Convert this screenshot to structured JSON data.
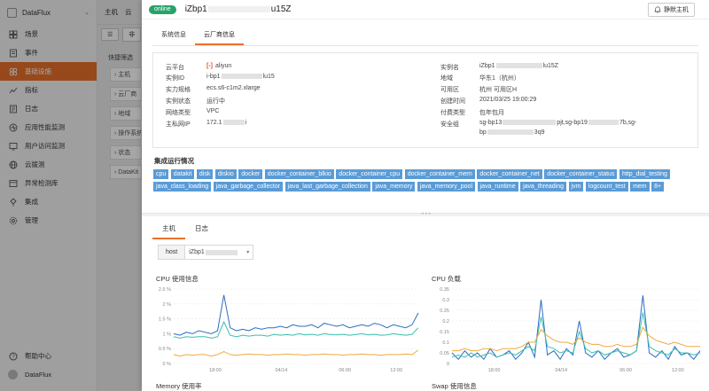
{
  "sidebar": {
    "app_name": "DataFlux",
    "items": [
      {
        "label": "场景",
        "icon": "scene-icon"
      },
      {
        "label": "事件",
        "icon": "event-icon"
      },
      {
        "label": "基础设施",
        "icon": "infrastructure-icon",
        "active": true
      },
      {
        "label": "指标",
        "icon": "metrics-icon"
      },
      {
        "label": "日志",
        "icon": "log-icon"
      },
      {
        "label": "应用性能监测",
        "icon": "apm-icon"
      },
      {
        "label": "用户访问监测",
        "icon": "rum-icon"
      },
      {
        "label": "云拨测",
        "icon": "dial-test-icon"
      },
      {
        "label": "异常检测库",
        "icon": "anomaly-icon"
      },
      {
        "label": "集成",
        "icon": "integration-icon"
      },
      {
        "label": "管理",
        "icon": "management-icon"
      }
    ],
    "help": "帮助中心",
    "account": "DataFlux"
  },
  "middle": {
    "tab_main": "主机",
    "tab_second": "云",
    "btn1": "☰",
    "btn2": "非",
    "quick_filter": "快捷筛选",
    "filters": [
      "› 主机",
      "› 云厂商",
      "› 地域",
      "› 操作系统",
      "› 状态",
      "› DataKit"
    ]
  },
  "drawer": {
    "status": "online",
    "title_prefix": "iZbp1",
    "title_suffix": "u15Z",
    "mute_label": "静默主机",
    "tabs": [
      "系统信息",
      "云厂商信息"
    ],
    "active_tab": 1,
    "info_left": [
      {
        "key": "云平台",
        "value": "aliyun"
      },
      {
        "key": "实例ID",
        "value_prefix": "i-bp1",
        "value_suffix": "lu15"
      },
      {
        "key": "实力规格",
        "value": "ecs.s6-c1m2.xlarge"
      },
      {
        "key": "实例状态",
        "value": "运行中"
      },
      {
        "key": "网络类型",
        "value": "VPC"
      },
      {
        "key": "主私网IP",
        "value_prefix": "172.1",
        "value_suffix": "i"
      }
    ],
    "info_right": [
      {
        "key": "实例名",
        "value_prefix": "iZbp1",
        "value_suffix": "lu15Z"
      },
      {
        "key": "地域",
        "value": "华东1（杭州）"
      },
      {
        "key": "可用区",
        "value": "杭州 可用区H"
      },
      {
        "key": "创建时间",
        "value": "2021/03/25 19:00:29"
      },
      {
        "key": "付费类型",
        "value": "包年包月"
      },
      {
        "key": "安全组",
        "value_line1_a": "sg-bp13",
        "value_line1_b": "pjt,sg-bp19",
        "value_line1_c": "7b,sg-",
        "value_line2_a": "bp",
        "value_line2_b": "3q9"
      }
    ],
    "integration_title": "集成运行情况",
    "integrations": [
      "cpu",
      "datakit",
      "disk",
      "diskio",
      "docker",
      "docker_container_blkio",
      "docker_container_cpu",
      "docker_container_mem",
      "docker_container_net",
      "docker_container_status",
      "http_dial_testing",
      "java_class_loading",
      "java_garbage_collector",
      "java_last_garbage_collection",
      "java_memory",
      "java_memory_pool",
      "java_runtime",
      "java_threading",
      "jvm",
      "logcount_test",
      "mem",
      "8+"
    ],
    "tabs2": [
      "主机",
      "日志"
    ],
    "host_label": "host",
    "host_value_prefix": "iZbp1",
    "charts": {
      "cpu_usage_title": "CPU 使用信息",
      "cpu_load_title": "CPU 负载",
      "memory_title": "Memory 使用率",
      "swap_title": "Swap 使用信息"
    }
  },
  "chart_data": [
    {
      "type": "line",
      "title": "CPU 使用信息",
      "yticks": [
        "2.5 %",
        "2 %",
        "1.5 %",
        "1 %",
        "0.5 %",
        "0 %"
      ],
      "ylim": [
        0,
        2.5
      ],
      "xticks": [
        "18:00",
        "04/14",
        "06:00",
        "12:00"
      ],
      "series": [
        {
          "color": "#2b6cc4",
          "values": [
            1.0,
            0.95,
            1.05,
            1.0,
            1.1,
            1.05,
            1.0,
            1.1,
            2.3,
            1.2,
            1.1,
            1.15,
            1.1,
            1.2,
            1.15,
            1.2,
            1.2,
            1.25,
            1.2,
            1.3,
            1.25,
            1.25,
            1.3,
            1.2,
            1.35,
            1.3,
            1.25,
            1.3,
            1.2,
            1.25,
            1.3,
            1.25,
            1.35,
            1.3,
            1.2,
            1.3,
            1.25,
            1.2,
            1.3,
            1.7
          ]
        },
        {
          "color": "#3bbfb0",
          "values": [
            0.9,
            0.85,
            0.9,
            0.88,
            0.9,
            0.9,
            0.85,
            0.9,
            1.4,
            0.95,
            0.9,
            0.95,
            0.92,
            0.95,
            0.95,
            0.92,
            0.98,
            0.95,
            0.97,
            0.95,
            1.0,
            0.96,
            0.98,
            0.95,
            1.0,
            0.97,
            0.96,
            0.98,
            0.95,
            0.97,
            1.0,
            0.96,
            0.98,
            0.95,
            0.96,
            1.0,
            0.97,
            0.95,
            0.98,
            1.2
          ]
        },
        {
          "color": "#f0a93b",
          "values": [
            0.3,
            0.25,
            0.3,
            0.28,
            0.3,
            0.3,
            0.25,
            0.3,
            0.4,
            0.3,
            0.28,
            0.3,
            0.32,
            0.3,
            0.3,
            0.28,
            0.3,
            0.3,
            0.32,
            0.3,
            0.3,
            0.28,
            0.3,
            0.3,
            0.32,
            0.3,
            0.3,
            0.28,
            0.3,
            0.3,
            0.32,
            0.3,
            0.3,
            0.28,
            0.3,
            0.3,
            0.3,
            0.32,
            0.3,
            0.45
          ]
        }
      ]
    },
    {
      "type": "line",
      "title": "CPU 负载",
      "yticks": [
        "0.35",
        "0.3",
        "0.25",
        "0.2",
        "0.15",
        "0.1",
        "0.05",
        "0"
      ],
      "ylim": [
        0,
        0.35
      ],
      "xticks": [
        "18:00",
        "04/14",
        "06:00",
        "12:00"
      ],
      "series": [
        {
          "color": "#2b6cc4",
          "values": [
            0.05,
            0.02,
            0.06,
            0.03,
            0.05,
            0.02,
            0.07,
            0.03,
            0.04,
            0.06,
            0.02,
            0.05,
            0.1,
            0.03,
            0.3,
            0.04,
            0.06,
            0.02,
            0.07,
            0.04,
            0.2,
            0.05,
            0.03,
            0.06,
            0.02,
            0.05,
            0.07,
            0.03,
            0.04,
            0.06,
            0.32,
            0.05,
            0.03,
            0.06,
            0.02,
            0.08,
            0.04,
            0.05,
            0.02,
            0.06
          ]
        },
        {
          "color": "#3bbfb0",
          "values": [
            0.03,
            0.04,
            0.03,
            0.05,
            0.03,
            0.04,
            0.05,
            0.03,
            0.04,
            0.05,
            0.04,
            0.06,
            0.08,
            0.06,
            0.22,
            0.08,
            0.07,
            0.05,
            0.06,
            0.05,
            0.15,
            0.07,
            0.05,
            0.06,
            0.04,
            0.05,
            0.06,
            0.05,
            0.04,
            0.06,
            0.24,
            0.08,
            0.06,
            0.05,
            0.04,
            0.07,
            0.05,
            0.05,
            0.04,
            0.05
          ]
        },
        {
          "color": "#f0a93b",
          "values": [
            0.06,
            0.06,
            0.07,
            0.06,
            0.06,
            0.07,
            0.07,
            0.06,
            0.07,
            0.07,
            0.07,
            0.08,
            0.1,
            0.1,
            0.16,
            0.13,
            0.11,
            0.1,
            0.1,
            0.09,
            0.12,
            0.1,
            0.09,
            0.09,
            0.08,
            0.08,
            0.09,
            0.08,
            0.08,
            0.09,
            0.17,
            0.13,
            0.11,
            0.1,
            0.09,
            0.1,
            0.09,
            0.08,
            0.08,
            0.08
          ]
        }
      ]
    }
  ]
}
